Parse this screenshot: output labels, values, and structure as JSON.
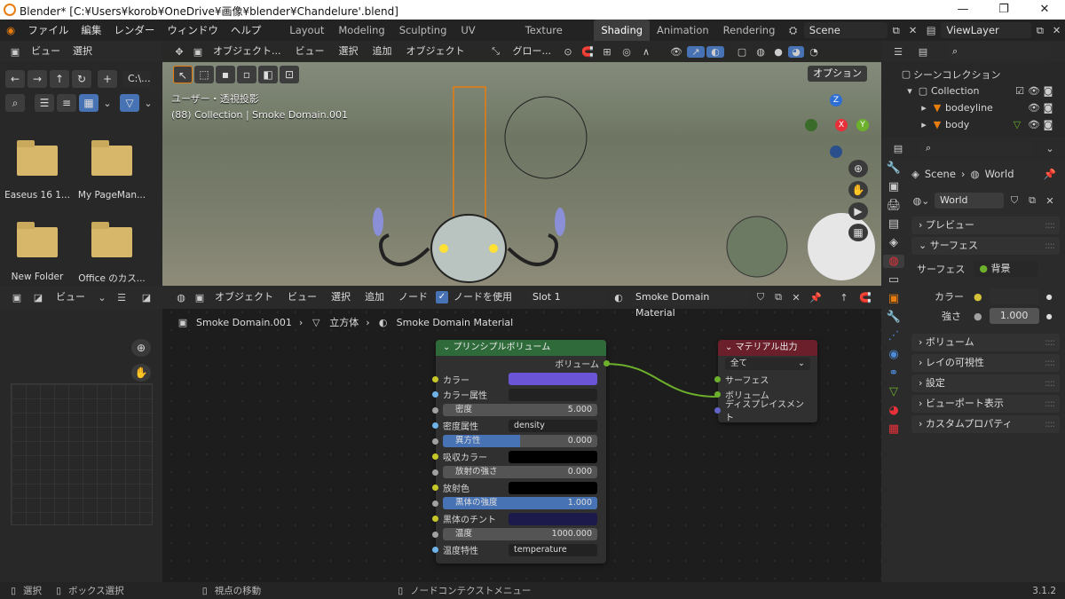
{
  "titlebar": {
    "title": "Blender* [C:¥Users¥korob¥OneDrive¥画像¥blender¥Chandelure'.blend]"
  },
  "menu": [
    "ファイル",
    "編集",
    "レンダー",
    "ウィンドウ",
    "ヘルプ"
  ],
  "workspaces": [
    "Layout",
    "Modeling",
    "Sculpting",
    "UV Editing",
    "Texture Paint",
    "Shading",
    "Animation",
    "Rendering"
  ],
  "active_workspace": "Shading",
  "scene": "Scene",
  "viewlayer": "ViewLayer",
  "filebrowser": {
    "menu": [
      "ビュー",
      "選択"
    ],
    "path": "C:\\...",
    "items": [
      "Easeus 16 1...",
      "My PageMan...",
      "New Folder",
      "Office のカス..."
    ]
  },
  "viewport": {
    "header": [
      "オブジェクト...",
      "ビュー",
      "選択",
      "追加",
      "オブジェクト"
    ],
    "transform": "グロー...",
    "options": "オプション",
    "info_line1": "ユーザー・透視投影",
    "info_line2": "(88) Collection | Smoke Domain.001",
    "axes": {
      "z": "Z",
      "x": "X",
      "y": "Y"
    }
  },
  "outliner": {
    "title": "シーンコレクション",
    "items": [
      "Collection",
      "bodeyline",
      "body"
    ]
  },
  "node_editor": {
    "header": [
      "オブジェクト",
      "ビュー",
      "選択",
      "追加",
      "ノード"
    ],
    "use_nodes": "ノードを使用",
    "slot": "Slot 1",
    "material": "Smoke Domain Material",
    "breadcrumb": [
      "Smoke Domain.001",
      "立方体",
      "Smoke Domain Material"
    ],
    "view": "ビュー"
  },
  "node_principled": {
    "title": "プリンシプルボリューム",
    "output": "ボリューム",
    "inputs": [
      {
        "label": "カラー",
        "kind": "color",
        "color": "#6b55d6"
      },
      {
        "label": "カラー属性",
        "kind": "text",
        "value": ""
      },
      {
        "label": "密度",
        "kind": "num",
        "value": "5.000"
      },
      {
        "label": "密度属性",
        "kind": "text",
        "value": "density"
      },
      {
        "label": "異方性",
        "kind": "num",
        "value": "0.000",
        "fill": 0.5
      },
      {
        "label": "吸収カラー",
        "kind": "color",
        "color": "#000000"
      },
      {
        "label": "放射の強さ",
        "kind": "num",
        "value": "0.000"
      },
      {
        "label": "放射色",
        "kind": "color",
        "color": "#000000"
      },
      {
        "label": "黒体の強度",
        "kind": "num",
        "value": "1.000",
        "fill": 1.0
      },
      {
        "label": "黒体のチント",
        "kind": "color",
        "color": "#1c1a4a"
      },
      {
        "label": "温度",
        "kind": "num",
        "value": "1000.000"
      },
      {
        "label": "温度特性",
        "kind": "text",
        "value": "temperature"
      }
    ]
  },
  "node_output": {
    "title": "マテリアル出力",
    "target": "全て",
    "inputs": [
      "サーフェス",
      "ボリューム",
      "ディスプレイスメント"
    ]
  },
  "properties": {
    "breadcrumb": [
      "Scene",
      "World"
    ],
    "world_name": "World",
    "panels_top": [
      "プレビュー",
      "サーフェス"
    ],
    "surface_label": "サーフェス",
    "surface_value": "背景",
    "color_label": "カラー",
    "strength_label": "強さ",
    "strength_value": "1.000",
    "panels_bottom": [
      "ボリューム",
      "レイの可視性",
      "設定",
      "ビューポート表示",
      "カスタムプロパティ"
    ]
  },
  "status": {
    "select": "選択",
    "box_select": "ボックス選択",
    "move_view": "視点の移動",
    "context_menu": "ノードコンテクストメニュー",
    "version": "3.1.2"
  }
}
